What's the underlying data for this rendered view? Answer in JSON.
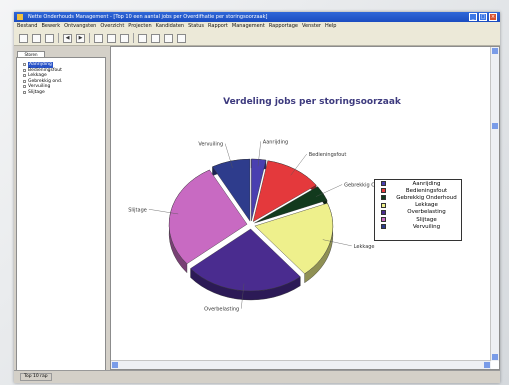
{
  "window": {
    "title": "Nette Onderhouds Management - [Top 10 een aantal jobs per Overdifhatie per storingsoorzaak]"
  },
  "menu": [
    "Bestand",
    "Bewerk",
    "Ontvangsten",
    "Overzicht",
    "Projecten",
    "Kandidaten",
    "Status",
    "Rapport",
    "Management",
    "Rapportage",
    "Venster",
    "Help"
  ],
  "sidebar": {
    "tab_label": "Storen",
    "items": [
      {
        "label": "Aanrijding"
      },
      {
        "label": "Bedieningsfout"
      },
      {
        "label": "Lekkage"
      },
      {
        "label": "Gebrekkig ond."
      },
      {
        "label": "Vervuiling"
      },
      {
        "label": "Slijtage"
      }
    ]
  },
  "chart_data": {
    "type": "pie",
    "title": "Verdeling jobs per storingsoorzaak",
    "series": [
      {
        "name": "Aanrijding",
        "value": 3,
        "color": "#4a3fb0"
      },
      {
        "name": "Bedieningsfout",
        "value": 12,
        "color": "#e4393c"
      },
      {
        "name": "Gebrekkig Onderhoud",
        "value": 4,
        "color": "#123a1d"
      },
      {
        "name": "Lekkage",
        "value": 20,
        "color": "#eef08c"
      },
      {
        "name": "Overbelasting",
        "value": 25,
        "color": "#4a2c8f"
      },
      {
        "name": "Slijtage",
        "value": 28,
        "color": "#c86ac2"
      },
      {
        "name": "Vervuiling",
        "value": 8,
        "color": "#2e3c8c"
      }
    ],
    "legend_position": "right"
  },
  "status": {
    "text": "Top 10 rap"
  }
}
